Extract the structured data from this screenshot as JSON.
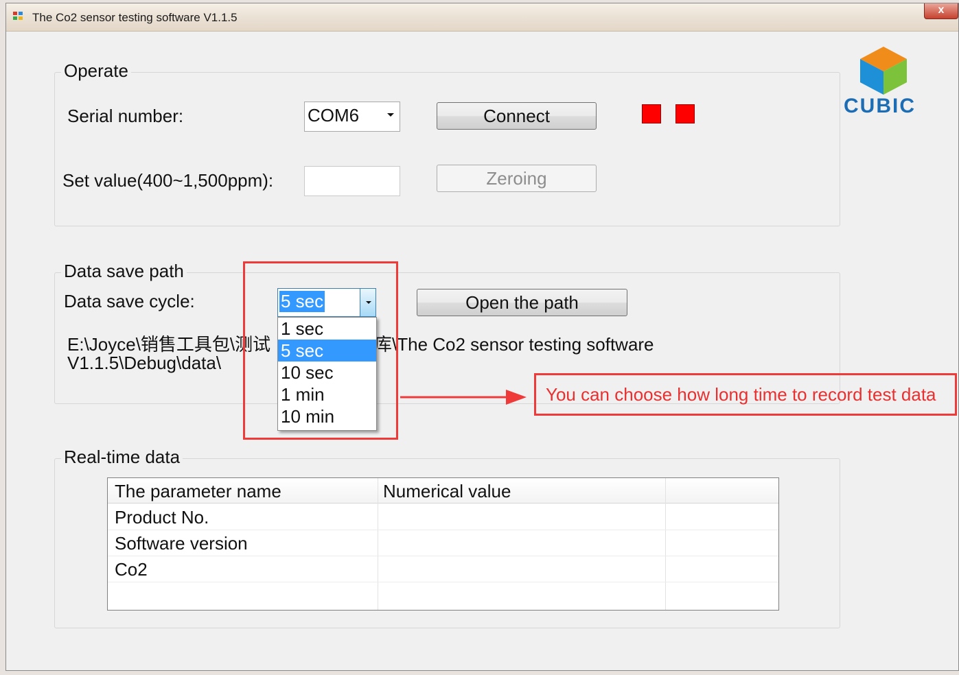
{
  "window": {
    "title": "The Co2 sensor testing software V1.1.5",
    "close_label": "x"
  },
  "logo": {
    "text": "CUBIC"
  },
  "operate": {
    "legend": "Operate",
    "serial_label": "Serial number:",
    "serial_value": "COM6",
    "connect_label": "Connect",
    "set_value_label": "Set value(400~1,500ppm):",
    "set_value": "",
    "zeroing_label": "Zeroing",
    "indicator_colors": [
      "#ff0000",
      "#ff0000"
    ]
  },
  "data_save": {
    "legend": "Data save path",
    "cycle_label": "Data save cycle:",
    "cycle_value": "5 sec",
    "open_path_label": "Open the path",
    "path_line1": "E:\\Joyce\\销售工具包\\测试",
    "path_line1b": "库\\The Co2 sensor testing software",
    "path_line2": "V1.1.5\\Debug\\data\\",
    "options": [
      "1 sec",
      "5 sec",
      "10 sec",
      "1 min",
      "10 min"
    ],
    "selected_option": "5 sec"
  },
  "realtime": {
    "legend": "Real-time data",
    "columns": [
      "The parameter name",
      "Numerical value",
      ""
    ],
    "rows": [
      [
        "Product No.",
        "",
        ""
      ],
      [
        "Software version",
        "",
        ""
      ],
      [
        "Co2",
        "",
        ""
      ],
      [
        "",
        "",
        ""
      ]
    ]
  },
  "annotation": {
    "text": "You can choose how long time to record test data",
    "color": "#e83030"
  }
}
